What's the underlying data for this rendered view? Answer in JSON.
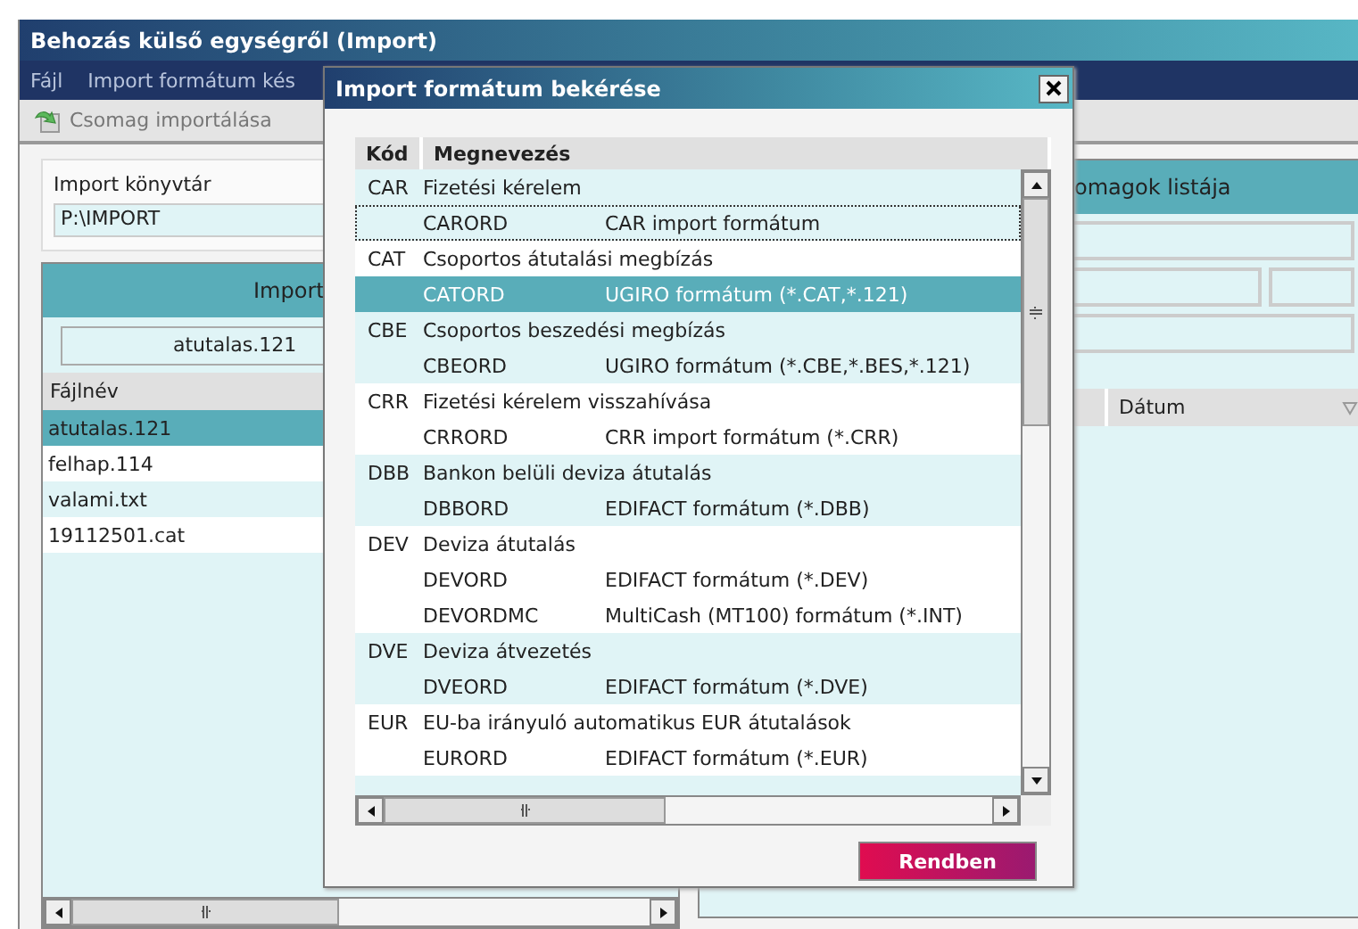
{
  "window": {
    "title": "Behozás külső egységről (Import)"
  },
  "menu": [
    "Fájl",
    "Import formátum kés"
  ],
  "toolbar": [
    {
      "label": "Csomag importálása"
    }
  ],
  "import_dir": {
    "label": "Import könyvtár",
    "value": "P:\\IMPORT"
  },
  "file_panel": {
    "title": "Import",
    "search": "atutalas.121",
    "column": "Fájlnév",
    "files": [
      {
        "name": "atutalas.121",
        "selected": true
      },
      {
        "name": "felhap.114",
        "selected": false
      },
      {
        "name": "valami.txt",
        "selected": false
      },
      {
        "name": "19112501.cat",
        "selected": false
      }
    ]
  },
  "package_panel": {
    "title": "omagok listája",
    "column": "Dátum"
  },
  "dialog": {
    "title": "Import formátum bekérése",
    "columns": [
      "Kód",
      "Megnevezés"
    ],
    "groups": [
      {
        "code": "CAR",
        "name": "Fizetési kérelem",
        "formats": [
          {
            "code": "CARORD",
            "description": "CAR import formátum",
            "selected": false,
            "focused": true
          }
        ]
      },
      {
        "code": "CAT",
        "name": "Csoportos átutalási megbízás",
        "formats": [
          {
            "code": "CATORD",
            "description": "UGIRO formátum  (*.CAT,*.121)",
            "selected": true,
            "focused": false
          }
        ]
      },
      {
        "code": "CBE",
        "name": "Csoportos beszedési megbízás",
        "formats": [
          {
            "code": "CBEORD",
            "description": "UGIRO formátum  (*.CBE,*.BES,*.121)",
            "selected": false,
            "focused": false
          }
        ]
      },
      {
        "code": "CRR",
        "name": "Fizetési kérelem visszahívása",
        "formats": [
          {
            "code": "CRRORD",
            "description": "CRR import formátum  (*.CRR)",
            "selected": false,
            "focused": false
          }
        ]
      },
      {
        "code": "DBB",
        "name": "Bankon belüli deviza átutalás",
        "formats": [
          {
            "code": "DBBORD",
            "description": "EDIFACT formátum  (*.DBB)",
            "selected": false,
            "focused": false
          }
        ]
      },
      {
        "code": "DEV",
        "name": "Deviza átutalás",
        "formats": [
          {
            "code": "DEVORD",
            "description": "EDIFACT formátum  (*.DEV)",
            "selected": false,
            "focused": false
          },
          {
            "code": "DEVORDMC",
            "description": "MultiCash (MT100) formátum  (*.INT)",
            "selected": false,
            "focused": false
          }
        ]
      },
      {
        "code": "DVE",
        "name": "Deviza átvezetés",
        "formats": [
          {
            "code": "DVEORD",
            "description": "EDIFACT formátum  (*.DVE)",
            "selected": false,
            "focused": false
          }
        ]
      },
      {
        "code": "EUR",
        "name": "EU-ba irányuló automatikus EUR átutalások",
        "formats": [
          {
            "code": "EURORD",
            "description": "EDIFACT formátum  (*.EUR)",
            "selected": false,
            "focused": false
          }
        ]
      }
    ],
    "button": "Rendben"
  }
}
